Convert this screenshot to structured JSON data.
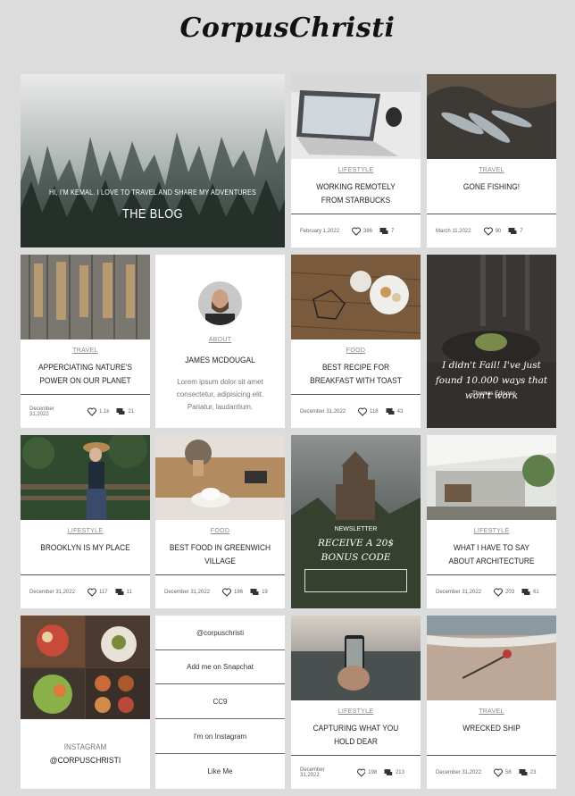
{
  "site": {
    "logo": "CorpusChristi"
  },
  "hero": {
    "subtitle": "HI, I'M KEMAL. I LOVE TO TRAVEL AND SHARE MY ADVENTURES",
    "title": "THE BLOG"
  },
  "posts": [
    {
      "category": "LIFESTYLE",
      "title": "WORKING REMOTELY FROM STARBUCKS",
      "date": "February 1,2022",
      "likes": "386",
      "comments": "7"
    },
    {
      "category": "TRAVEL",
      "title": "GONE FISHING!",
      "date": "March 11,2022",
      "likes": "90",
      "comments": "7"
    },
    {
      "category": "TRAVEL",
      "title": "APPERCIATING NATURE'S POWER ON OUR PLANET",
      "date": "December 31,2022",
      "likes": "1.1k",
      "comments": "21"
    },
    {
      "category": "FOOD",
      "title": "BEST RECIPE FOR BREAKFAST WITH TOAST",
      "date": "December 31,2022",
      "likes": "118",
      "comments": "43"
    },
    {
      "category": "LIFESTYLE",
      "title": "BROOKLYN IS MY PLACE",
      "date": "December 31,2022",
      "likes": "117",
      "comments": "11"
    },
    {
      "category": "FOOD",
      "title": "BEST FOOD IN GREENWICH VILLAGE",
      "date": "December 31,2022",
      "likes": "186",
      "comments": "19"
    },
    {
      "category": "LIFESTYLE",
      "title": "WHAT I HAVE TO SAY ABOUT ARCHITECTURE",
      "date": "December 31,2022",
      "likes": "203",
      "comments": "61"
    },
    {
      "category": "LIFESTYLE",
      "title": "CAPTURING WHAT YOU HOLD DEAR",
      "date": "December 31,2022",
      "likes": "198",
      "comments": "213"
    },
    {
      "category": "TRAVEL",
      "title": "WRECKED SHIP",
      "date": "December 31,2022",
      "likes": "58",
      "comments": "23"
    }
  ],
  "about": {
    "category": "ABOUT",
    "name": "JAMES McDOUGAL",
    "text": "Lorem ipsum dolor sit amet consectetur, adipisicing elit. Pariatur, laudantium."
  },
  "quote": {
    "text": "I didn't Fail! I've just found 10.000 ways that won't work",
    "author": "-Thomas Edison"
  },
  "newsletter": {
    "label": "NEWSLETTER",
    "title": "RECEIVE A 20$ BONUS CODE"
  },
  "instagram": {
    "label": "INSTAGRAM",
    "handle": "@CORPUSCHRISTI"
  },
  "links": [
    "@corpuschristi",
    "Add me on Snapchat",
    "CC9",
    "I'm on Instagram",
    "Like Me"
  ]
}
